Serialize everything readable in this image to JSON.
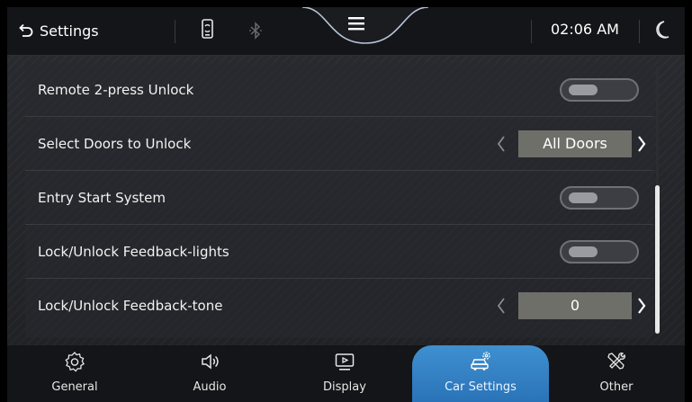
{
  "header": {
    "back_label": "Settings",
    "time": "02:06 AM",
    "icons": [
      "back-arrow-icon",
      "phone-link-icon",
      "bluetooth-icon",
      "menu-icon",
      "moon-icon"
    ]
  },
  "settings": {
    "rows": [
      {
        "label": "Remote 2-press Unlock",
        "control": "toggle",
        "enabled": false
      },
      {
        "label": "Select Doors to Unlock",
        "control": "selector",
        "value": "All Doors"
      },
      {
        "label": "Entry Start System",
        "control": "toggle",
        "enabled": false
      },
      {
        "label": "Lock/Unlock Feedback-lights",
        "control": "toggle",
        "enabled": false
      },
      {
        "label": "Lock/Unlock Feedback-tone",
        "control": "selector",
        "value": "0"
      }
    ]
  },
  "nav": {
    "items": [
      {
        "label": "General",
        "icon": "gear-icon",
        "active": false
      },
      {
        "label": "Audio",
        "icon": "speaker-icon",
        "active": false
      },
      {
        "label": "Display",
        "icon": "display-icon",
        "active": false
      },
      {
        "label": "Car Settings",
        "icon": "car-settings-icon",
        "active": true
      },
      {
        "label": "Other",
        "icon": "tools-icon",
        "active": false
      }
    ]
  },
  "colors": {
    "accent": "#3486c8",
    "selector_bg": "#6f6f6a",
    "background": "#232428"
  }
}
